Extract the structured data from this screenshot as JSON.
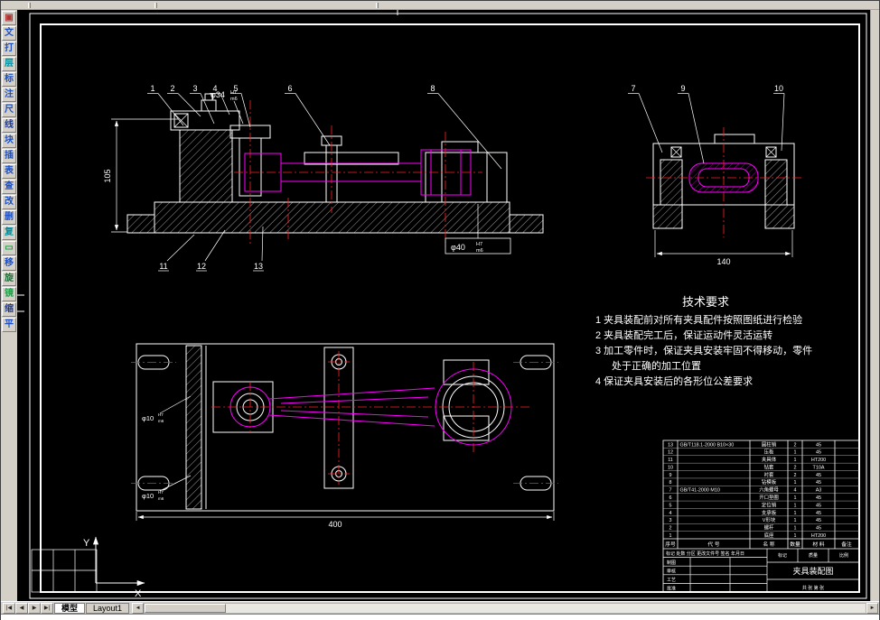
{
  "tabs": {
    "model": "模型",
    "layout1": "Layout1"
  },
  "nav": {
    "first": "|◀",
    "prev": "◀",
    "next": "▶",
    "last": "▶|",
    "scroll_left": "◄",
    "scroll_right": "►"
  },
  "left_toolbar": {
    "icons": [
      {
        "name": "new-drawing-icon",
        "glyph": "▣",
        "color": "#b03434"
      },
      {
        "name": "text-style-icon",
        "glyph": "文",
        "color": "#1b50c8"
      },
      {
        "name": "print-icon",
        "glyph": "打",
        "color": "#1b50c8"
      },
      {
        "name": "layer-manager-icon",
        "glyph": "层",
        "color": "#008fa0"
      },
      {
        "name": "dimension-icon",
        "glyph": "标",
        "color": "#1b50c8"
      },
      {
        "name": "annotation-icon",
        "glyph": "注",
        "color": "#1b50c8"
      },
      {
        "name": "measure-icon",
        "glyph": "尺",
        "color": "#1b50c8"
      },
      {
        "name": "line-tool-icon",
        "glyph": "线",
        "color": "#223a8c"
      },
      {
        "name": "block-icon",
        "glyph": "块",
        "color": "#1b50c8"
      },
      {
        "name": "insert-icon",
        "glyph": "插",
        "color": "#1b50c8"
      },
      {
        "name": "table-icon",
        "glyph": "表",
        "color": "#1b50c8"
      },
      {
        "name": "query-icon",
        "glyph": "查",
        "color": "#1b50c8"
      },
      {
        "name": "modify-icon",
        "glyph": "改",
        "color": "#1b50c8"
      },
      {
        "name": "erase-icon",
        "glyph": "删",
        "color": "#1b50c8"
      },
      {
        "name": "copy-icon",
        "glyph": "复",
        "color": "#008fa0"
      },
      {
        "name": "rectangle-tool-icon",
        "glyph": "▭",
        "color": "#22a04a"
      },
      {
        "name": "move-icon",
        "glyph": "移",
        "color": "#1b50c8"
      },
      {
        "name": "rotate-icon",
        "glyph": "旋",
        "color": "#1f6e38"
      },
      {
        "name": "mirror-icon",
        "glyph": "镜",
        "color": "#22a04a"
      },
      {
        "name": "zoom-icon",
        "glyph": "缩",
        "color": "#223a8c"
      },
      {
        "name": "pan-icon",
        "glyph": "平",
        "color": "#1b50c8"
      }
    ]
  },
  "drawing": {
    "ucs": {
      "x_label": "X",
      "y_label": "Y"
    },
    "dims": {
      "v105": "105",
      "d34": "φ34",
      "d34_t": "H7",
      "d34_b": "m6",
      "d40": "φ40",
      "d40_t": "H7",
      "d40_b": "m6",
      "d10a": "φ10",
      "d10a_t": "H7",
      "d10a_b": "m6",
      "d10b": "φ10",
      "d10b_t": "H7",
      "d10b_b": "m6",
      "w140": "140",
      "w400": "400"
    },
    "callouts": {
      "c1": "1",
      "c2": "2",
      "c3": "3",
      "c4": "4",
      "c5": "5",
      "c6": "6",
      "c7": "7",
      "c8": "8",
      "c9": "9",
      "c10": "10",
      "c11": "11",
      "c12": "12",
      "c13": "13"
    },
    "tech": {
      "title": "技术要求",
      "lines": [
        "1  夹具装配前对所有夹具配件按照图纸进行检验",
        "2  夹具装配完工后，保证运动件灵活运转",
        "3  加工零件时，保证夹具安装牢固不得移动，零件",
        "处于正确的加工位置",
        "4  保证夹具安装后的各形位公差要求"
      ]
    },
    "parts_table": {
      "headers": [
        "序号",
        "代 号",
        "名 称",
        "数量",
        "材 料",
        "备注"
      ],
      "rows": [
        {
          "no": "13",
          "code": "GB/T118.1-2000 B10×30",
          "name": "圆柱销",
          "qty": "2",
          "mat": "45",
          "note": ""
        },
        {
          "no": "12",
          "code": "",
          "name": "压板",
          "qty": "1",
          "mat": "45",
          "note": ""
        },
        {
          "no": "11",
          "code": "",
          "name": "夹具体",
          "qty": "1",
          "mat": "HT200",
          "note": ""
        },
        {
          "no": "10",
          "code": "",
          "name": "钻套",
          "qty": "2",
          "mat": "T10A",
          "note": ""
        },
        {
          "no": "9",
          "code": "",
          "name": "衬套",
          "qty": "2",
          "mat": "45",
          "note": ""
        },
        {
          "no": "8",
          "code": "",
          "name": "钻模板",
          "qty": "1",
          "mat": "45",
          "note": ""
        },
        {
          "no": "7",
          "code": "GB/T41-2000 M10",
          "name": "六角螺母",
          "qty": "4",
          "mat": "A3",
          "note": ""
        },
        {
          "no": "6",
          "code": "",
          "name": "开口垫圈",
          "qty": "1",
          "mat": "45",
          "note": ""
        },
        {
          "no": "5",
          "code": "",
          "name": "定位销",
          "qty": "1",
          "mat": "45",
          "note": ""
        },
        {
          "no": "4",
          "code": "",
          "name": "支承板",
          "qty": "1",
          "mat": "45",
          "note": ""
        },
        {
          "no": "3",
          "code": "",
          "name": "V形块",
          "qty": "1",
          "mat": "45",
          "note": ""
        },
        {
          "no": "2",
          "code": "",
          "name": "螺杆",
          "qty": "1",
          "mat": "45",
          "note": ""
        },
        {
          "no": "1",
          "code": "",
          "name": "底座",
          "qty": "1",
          "mat": "HT200",
          "note": ""
        }
      ]
    },
    "title_block": {
      "name": "夹具装配图",
      "rev_header": "标记 处数 分区 更改文件号 签名 年月日",
      "row_labels": [
        "制图",
        "审核",
        "工艺",
        "批准"
      ],
      "cell_mark": "标记",
      "cell_weight": "质量",
      "cell_scale": "比例",
      "sheet": "共 张 第 张"
    }
  }
}
